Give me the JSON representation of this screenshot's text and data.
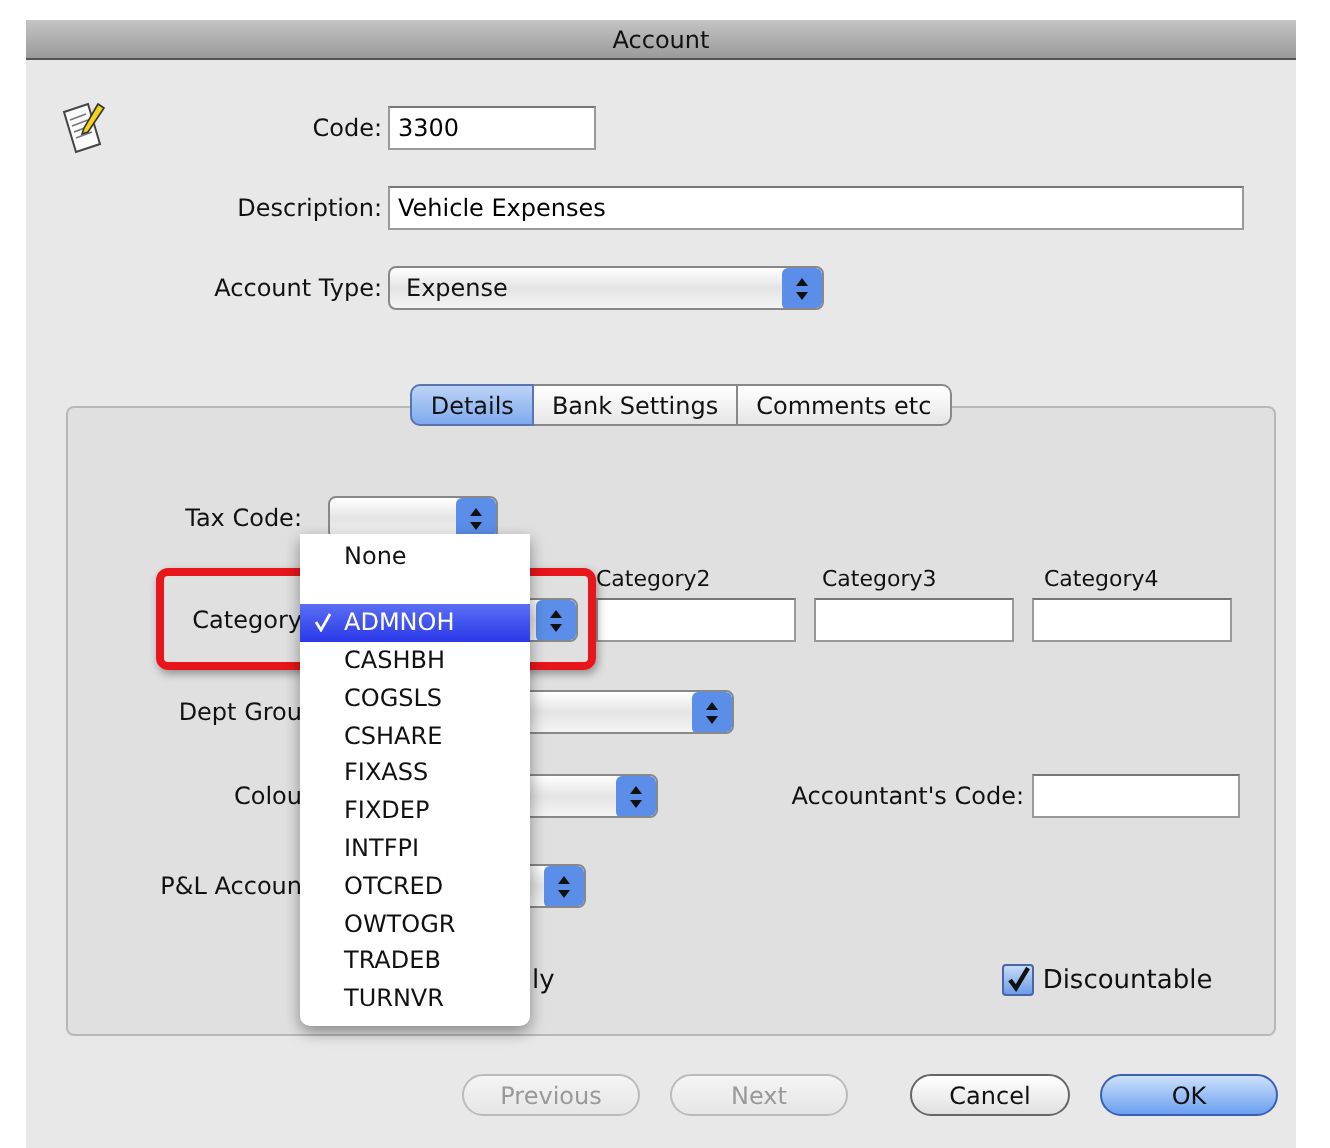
{
  "window": {
    "title": "Account"
  },
  "code": {
    "label": "Code:",
    "value": "3300"
  },
  "description": {
    "label": "Description:",
    "value": "Vehicle Expenses"
  },
  "account_type": {
    "label": "Account Type:",
    "value": "Expense"
  },
  "tabs": [
    {
      "label": "Details",
      "selected": true
    },
    {
      "label": "Bank Settings",
      "selected": false
    },
    {
      "label": "Comments etc",
      "selected": false
    }
  ],
  "tax_code": {
    "label": "Tax Code:"
  },
  "category": {
    "label": "Category"
  },
  "category_fields": [
    {
      "label": "Category2"
    },
    {
      "label": "Category3"
    },
    {
      "label": "Category4"
    }
  ],
  "dept_group": {
    "label": "Dept Grou"
  },
  "colour": {
    "label": "Colou"
  },
  "accountants_code": {
    "label": "Accountant's Code:"
  },
  "pl_account": {
    "label": "P&L Accoun"
  },
  "hidden_option": {
    "label": "ly"
  },
  "discountable": {
    "label": "Discountable",
    "checked": true
  },
  "menu": {
    "items": [
      {
        "kind": "item",
        "label": "None",
        "selected": false
      },
      {
        "kind": "separator"
      },
      {
        "kind": "item",
        "label": "ADMNOH",
        "selected": true
      },
      {
        "kind": "item",
        "label": "CASHBH",
        "selected": false
      },
      {
        "kind": "item",
        "label": "COGSLS",
        "selected": false
      },
      {
        "kind": "item",
        "label": "CSHARE",
        "selected": false
      },
      {
        "kind": "item",
        "label": "FIXASS",
        "selected": false
      },
      {
        "kind": "item",
        "label": "FIXDEP",
        "selected": false
      },
      {
        "kind": "item",
        "label": "INTFPI",
        "selected": false
      },
      {
        "kind": "item",
        "label": "OTCRED",
        "selected": false
      },
      {
        "kind": "item",
        "label": "OWTOGR",
        "selected": false
      },
      {
        "kind": "item",
        "label": "TRADEB",
        "selected": false
      },
      {
        "kind": "item",
        "label": "TURNVR",
        "selected": false
      }
    ]
  },
  "buttons": [
    {
      "label": "Previous",
      "disabled": true,
      "default": false
    },
    {
      "label": "Next",
      "disabled": true,
      "default": false
    },
    {
      "label": "Cancel",
      "disabled": false,
      "default": false
    },
    {
      "label": "OK",
      "disabled": false,
      "default": true
    }
  ]
}
